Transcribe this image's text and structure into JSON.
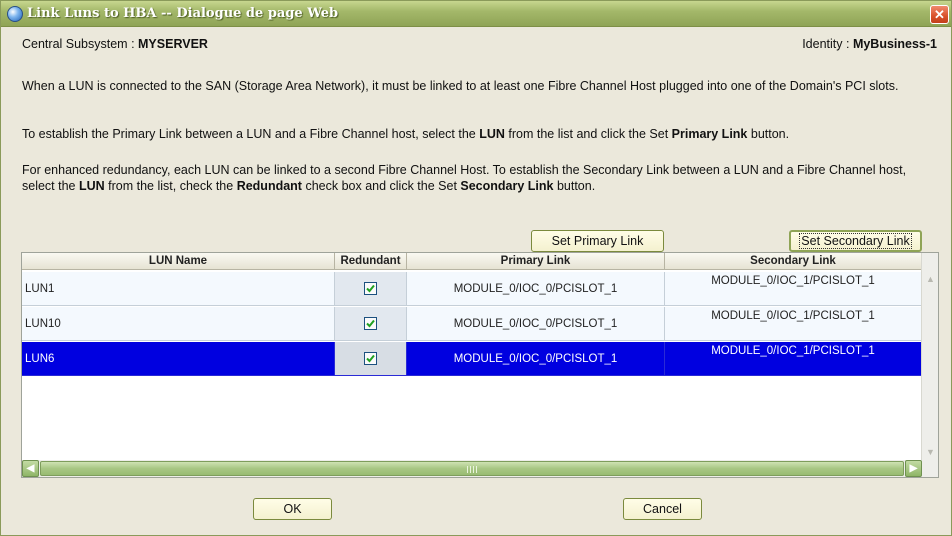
{
  "window": {
    "title": "Link Luns to HBA -- Dialogue de page Web",
    "close_glyph": "✕"
  },
  "header": {
    "subsystem_label": "Central Subsystem : ",
    "subsystem_value": "MYSERVER",
    "identity_label": "Identity : ",
    "identity_value": "MyBusiness-1"
  },
  "instructions": {
    "p1": "When a LUN is connected to the SAN (Storage Area Network), it must be linked to at least one Fibre Channel Host plugged into one of the Domain's PCI slots.",
    "p2_a": "To establish the Primary Link between a LUN and a Fibre Channel host, select the ",
    "p2_b": "LUN",
    "p2_c": " from the list and click the Set ",
    "p2_d": "Primary Link",
    "p2_e": " button.",
    "p3_a": "For enhanced redundancy, each LUN can be linked to a second Fibre Channel Host. To establish the Secondary Link between a LUN and a Fibre Channel host, select the ",
    "p3_b": "LUN",
    "p3_c": " from the list, check the ",
    "p3_d": "Redundant",
    "p3_e": " check box and click the Set ",
    "p3_f": "Secondary Link",
    "p3_g": " button."
  },
  "actions": {
    "set_primary": "Set Primary Link",
    "set_secondary": "Set Secondary Link",
    "ok": "OK",
    "cancel": "Cancel"
  },
  "table": {
    "columns": [
      "LUN Name",
      "Redundant",
      "Primary Link",
      "Secondary Link"
    ],
    "rows": [
      {
        "lun": "LUN1",
        "redundant": true,
        "primary": "MODULE_0/IOC_0/PCISLOT_1",
        "secondary": "MODULE_0/IOC_1/PCISLOT_1",
        "selected": false
      },
      {
        "lun": "LUN10",
        "redundant": true,
        "primary": "MODULE_0/IOC_0/PCISLOT_1",
        "secondary": "MODULE_0/IOC_1/PCISLOT_1",
        "selected": false
      },
      {
        "lun": "LUN6",
        "redundant": true,
        "primary": "MODULE_0/IOC_0/PCISLOT_1",
        "secondary": "MODULE_0/IOC_1/PCISLOT_1",
        "selected": true
      }
    ]
  },
  "icons": {
    "window_icon": "ie-globe-icon",
    "close": "close-icon",
    "scroll_left": "arrow-left-icon",
    "scroll_right": "arrow-right-icon",
    "scroll_up": "arrow-up-icon",
    "scroll_down": "arrow-down-icon",
    "check": "check-icon"
  },
  "colors": {
    "selection": "#0000e0",
    "titlebar": "#a4b86a"
  }
}
